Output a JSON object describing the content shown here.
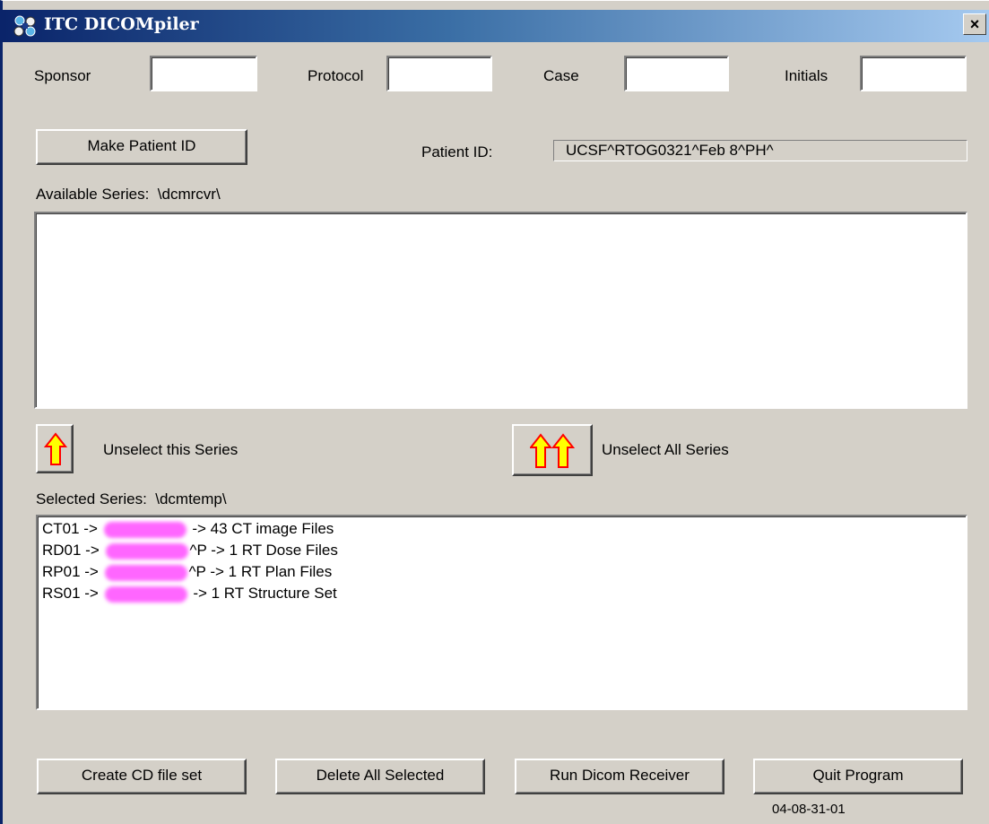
{
  "window": {
    "title": "ITC DICOMpiler",
    "close_label": "×"
  },
  "fields": {
    "sponsor_label": "Sponsor",
    "protocol_label": "Protocol",
    "case_label": "Case",
    "initials_label": "Initials",
    "sponsor_value": "",
    "protocol_value": "",
    "case_value": "",
    "initials_value": ""
  },
  "patient": {
    "make_button": "Make Patient ID",
    "id_label": "Patient ID:",
    "id_value": "UCSF^RTOG0321^Feb  8^PH^"
  },
  "available": {
    "label": "Available Series:",
    "path": "\\dcmrcvr\\",
    "items": []
  },
  "unselect": {
    "this_label": "Unselect this Series",
    "all_label": "Unselect All Series"
  },
  "selected": {
    "label": "Selected Series:",
    "path": "\\dcmtemp\\",
    "items": [
      {
        "prefix": "CT01 ->",
        "mid": "",
        "suffix": "->   43 CT image Files"
      },
      {
        "prefix": "RD01 ->",
        "mid": "^P",
        "suffix": "->   1 RT Dose Files"
      },
      {
        "prefix": "RP01 ->",
        "mid": "^P",
        "suffix": "->   1 RT Plan Files"
      },
      {
        "prefix": "RS01 ->",
        "mid": "",
        "suffix": "->   1 RT Structure Set"
      }
    ]
  },
  "buttons": {
    "create_cd": "Create CD file set",
    "delete_all": "Delete All Selected",
    "run_receiver": "Run Dicom Receiver",
    "quit": "Quit Program"
  },
  "version": "04-08-31-01",
  "icons": {
    "app": "dicompiler-app-icon",
    "arrow_up": "yellow-up-arrow-icon",
    "double_arrow_up": "yellow-double-up-arrow-icon"
  },
  "colors": {
    "title_gradient_start": "#0a246a",
    "title_gradient_end": "#a6caf0",
    "dialog_background": "#d4d0c8",
    "arrow_fill": "#ffff00",
    "arrow_outline": "#ff0000",
    "redaction": "#ff66ff"
  }
}
